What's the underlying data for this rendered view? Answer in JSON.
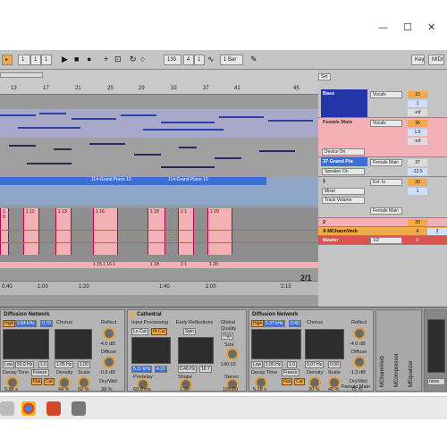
{
  "window": {
    "minimize": "—",
    "maximize": "☐",
    "close": "✕"
  },
  "transport": {
    "bar": "1",
    "beat": "1",
    "sixteenth": "1",
    "tempo": "130",
    "sig_num": "4",
    "sig_den": "1",
    "bars": "1 Bar",
    "key_label": "Key",
    "midi_label": "MIDI"
  },
  "ruler": {
    "marks": [
      "13",
      "17",
      "21",
      "25",
      "29",
      "33",
      "37",
      "41",
      "45"
    ],
    "set_label": "Set",
    "bottom_marks": [
      "0:40",
      "1:00",
      "1:20",
      "1:40",
      "2:00",
      "2:15"
    ],
    "page": "2/1"
  },
  "arrangement": {
    "clip_a": "114-Grand Piano 10",
    "clip_b": "114-Grand Piano 10",
    "pink_clips": [
      "1 9",
      "1 11",
      "1 13",
      "1 15",
      "1 16",
      "1 18",
      "2 1",
      "1 20"
    ],
    "pink_bottom": [
      "1 15 1 16 1",
      "1 18",
      "2 1",
      "1 20"
    ]
  },
  "tracks": {
    "bass": {
      "name": "Bass",
      "input": "Vocals",
      "n1": "15",
      "n2": "1",
      "n3": "-inf"
    },
    "female": {
      "name": "Female Main",
      "input": "Vocals",
      "n1": "36",
      "n2": "1.5",
      "n3": "-inf"
    },
    "device_on": "Device On",
    "grand": {
      "name": "37 Grand Pia",
      "input": "Female Main",
      "n1": "37",
      "n2": "-12.5"
    },
    "speaker": "Speaker On",
    "t1": {
      "name": "1",
      "input": "Ext. In",
      "n1": "30",
      "n2": "1"
    },
    "mixer": "Mixer",
    "track_volume": "Track Volume",
    "female2": "Female Main",
    "t2": {
      "name": "2",
      "n1": "39"
    },
    "reverb": {
      "name": "A MChannVerb",
      "letter": "A",
      "n1": "2"
    },
    "master": {
      "name": "Master",
      "ratio": "1/2",
      "n1": "0"
    }
  },
  "devices": {
    "diff1": {
      "title": "Diffusion Network",
      "high": "High",
      "hz": "2.84 kHz",
      "val": "0.70",
      "chorus": "Chorus",
      "low": "Low",
      "low_hz": "50.0 Hz",
      "amount": "1.0",
      "rate": "1.05 Hz",
      "rate2": "1.00",
      "reflect": "Reflect",
      "reflect_val": "-4.0 dB",
      "diffuse": "Diffuse",
      "diffuse_val": "-0.9 dB",
      "decay": "Decay Time",
      "decay_val": "5.86 s",
      "freeze": "Freeze",
      "flat": "Flat",
      "cut": "Cut",
      "density": "Density",
      "density_val": "44 %",
      "scale": "Scale",
      "scale_val": "60 %",
      "drywet": "Dry/Wet",
      "drywet_val": "38 %"
    },
    "cath": {
      "title": "Cathedral",
      "input": "Input Processing",
      "lo": "Lo Cut",
      "hi": "Hi Cut",
      "early": "Early Reflections",
      "spin": "Spin",
      "global": "Global",
      "quality": "Quality",
      "quality_val": "High",
      "hz1": "5.11 kHz",
      "q1": "4.22",
      "ms1": "0.46 Hz",
      "ms2": "18.7",
      "size": "Size",
      "size_val": "140.03",
      "predelay": "Predelay",
      "predelay_val": "60.0 ms",
      "shape": "Shape",
      "shape_val": "1.00",
      "stereo": "Stereo",
      "stereo_val": "100.00"
    },
    "diff2": {
      "title": "Diffusion Network",
      "high": "High",
      "hz": "5.37 kHz",
      "val": "0.40",
      "chorus": "Chorus",
      "low": "Low",
      "low_hz": "1.00 Hz",
      "amount": "1.0",
      "rate": "0.07 Hz",
      "rate2": "0.00",
      "reflect": "Reflect",
      "reflect_val": "-4.0 dB",
      "diffuse": "Diffuse",
      "diffuse_val": "-1.3 dB",
      "decay": "Decay Time",
      "decay_val": "5.28 s",
      "freeze": "Freeze",
      "flat": "Flat",
      "cut": "Cut",
      "density": "Density",
      "density_val": "20 %",
      "scale": "Scale",
      "scale_val": "40 %",
      "drywet": "Dry/Wet",
      "drywet_val": "75 %"
    },
    "strips": [
      "MChannVerb",
      "MCompressor",
      "MEqualizer"
    ],
    "none": "none",
    "female_main": "Female Main"
  },
  "colors": {
    "accent": "#f3a94a",
    "blue": "#3b6fd6",
    "pink": "#f3b1b6",
    "red": "#d9534f"
  }
}
